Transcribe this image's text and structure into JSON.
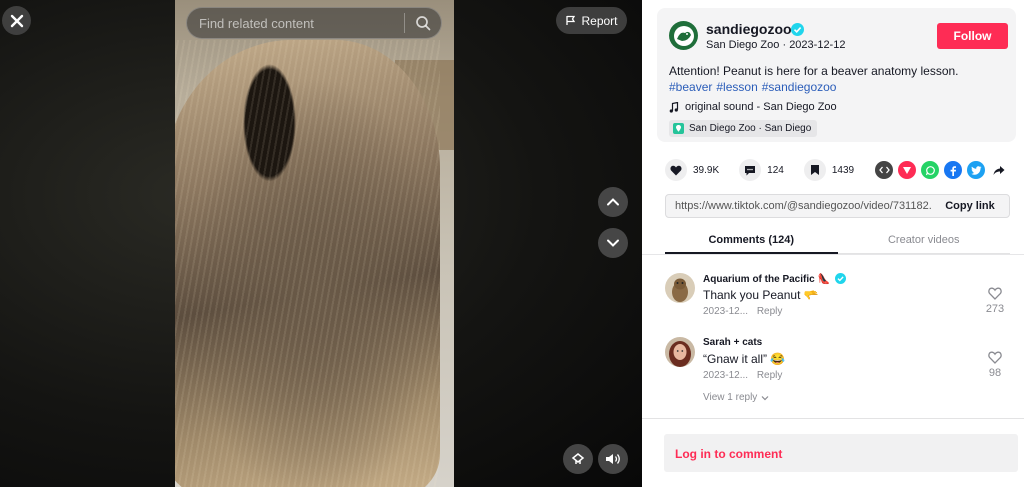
{
  "video": {
    "search_placeholder": "Find related content",
    "report_label": "Report",
    "icons": {
      "close": "close-icon",
      "search": "search-icon",
      "flag": "flag-icon",
      "prev": "chevron-up-icon",
      "next": "chevron-down-icon",
      "float": "floating-player-icon",
      "volume": "volume-icon"
    }
  },
  "author": {
    "username": "sandiegozoo",
    "display_name": "San Diego Zoo",
    "date": "2023-12-12",
    "separator": "·",
    "follow_label": "Follow"
  },
  "post": {
    "caption": "Attention! Peanut is here for a beaver anatomy lesson.",
    "hashtags": [
      "#beaver",
      "#lesson",
      "#sandiegozoo"
    ],
    "sound": "original sound - San Diego Zoo",
    "location": "San Diego Zoo · San Diego"
  },
  "stats": {
    "likes": "39.9K",
    "comments": "124",
    "saves": "1439"
  },
  "share": {
    "icons": [
      "embed-icon",
      "send-icon",
      "whatsapp-icon",
      "facebook-icon",
      "twitter-icon",
      "share-arrow-icon"
    ],
    "url": "https://www.tiktok.com/@sandiegozoo/video/731182...",
    "copy_label": "Copy link"
  },
  "tabs": {
    "comments": "Comments (124)",
    "creator": "Creator videos"
  },
  "comments": [
    {
      "user": "Aquarium of the Pacific",
      "user_emoji": "👠",
      "text": "Thank you Peanut 🫳",
      "date": "2023-12...",
      "reply": "Reply",
      "likes": "273"
    },
    {
      "user": "Sarah + cats",
      "text": "“Gnaw it all” 😂",
      "date": "2023-12...",
      "reply": "Reply",
      "likes": "98",
      "view_replies": "View 1 reply"
    }
  ],
  "login": "Log in to comment",
  "colors": {
    "brand": "#fe2c55",
    "link": "#2b5db9",
    "verified": "#20d5ec"
  }
}
